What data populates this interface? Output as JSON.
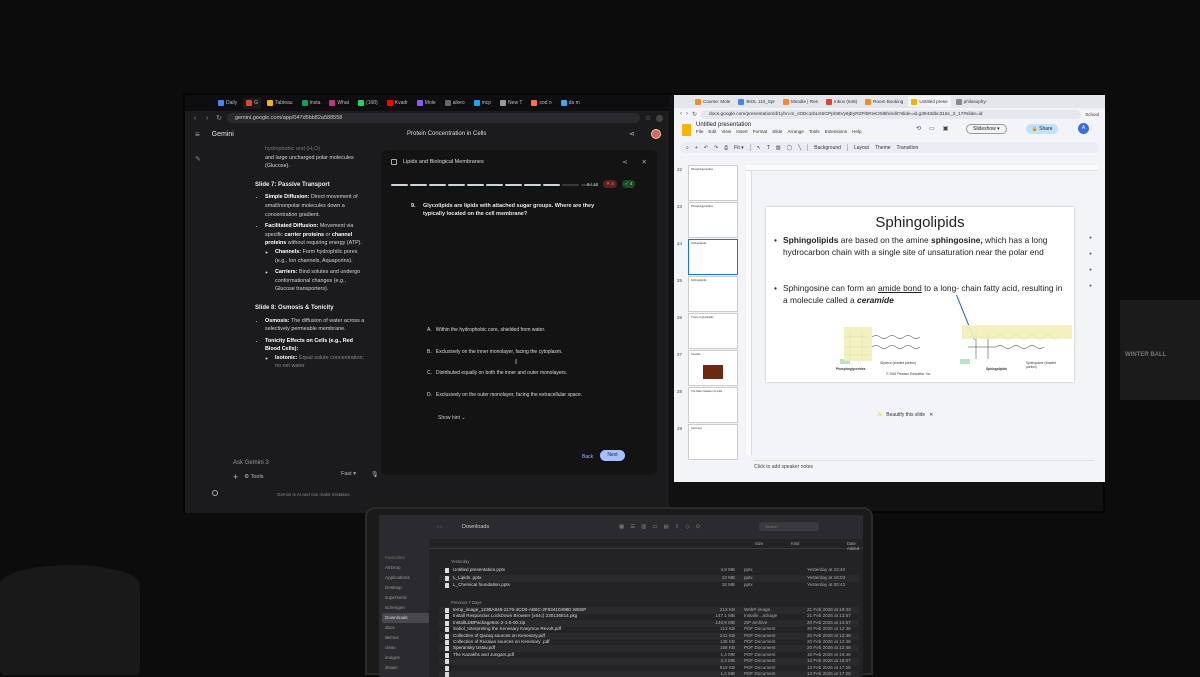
{
  "left_browser": {
    "tabs": [
      "Daily",
      "G",
      "Tableau",
      "Insta",
      "What",
      "(168)",
      "Kvadr",
      "Mole",
      "aikeo",
      "mcp",
      "New T",
      "sod n",
      "da m"
    ],
    "url": "gemini.google.com/app/047d5bb82a588558",
    "brand": "Gemini",
    "chat_title": "Protein Concentration in Cells",
    "notes": {
      "intro": "and large uncharged polar molecules (Glucose).",
      "intro_partial": "hydrophobic and (H₂O)",
      "slide7_title": "Slide 7: Passive Transport",
      "simple_diffusion_label": "Simple Diffusion:",
      "simple_diffusion_text": "Direct movement of small/nonpolar molecules down a concentration gradient.",
      "facilitated_label": "Facilitated Diffusion:",
      "facilitated_text_1": "Movement via specific",
      "carrier_proteins": "carrier proteins",
      "or": "or",
      "channel_proteins": "channel proteins",
      "facilitated_text_2": "without requiring energy (ATP).",
      "channels_label": "Channels:",
      "channels_text": "Form hydrophilic pores (e.g., Ion channels, Aquaporins).",
      "carriers_label": "Carriers:",
      "carriers_text": "Bind solutes and undergo conformational changes (e.g., Glucose transporters).",
      "slide8_title": "Slide 8: Osmosis & Tonicity",
      "osmosis_label": "Osmosis:",
      "osmosis_text": "The diffusion of water across a selectively permeable membrane.",
      "tonicity_label": "Tonicity Effects on Cells (e.g., Red Blood Cells):",
      "isotonic_label": "Isotonic:",
      "isotonic_text": "Equal solute concentration; no net water"
    },
    "ask_placeholder": "Ask Gemini 3",
    "tools_label": "Tools",
    "mode_label": "Fast",
    "disclaimer": "Gemini is AI and can make mistakes.",
    "quiz": {
      "title": "Lipids and Biological Membranes",
      "progress": "9 / 10",
      "progress_fraction": 0.8,
      "wrong_count": "4",
      "right_count": "4",
      "question_number": "9.",
      "question": "Glycolipids are lipids with attached sugar groups. Where are they typically located on the cell membrane?",
      "options": [
        {
          "letter": "A.",
          "text": "Within the hydrophobic core, shielded from water."
        },
        {
          "letter": "B.",
          "text": "Exclusively on the inner monolayer, facing the cytoplasm."
        },
        {
          "letter": "C.",
          "text": "Distributed equally on both the inner and outer monolayers."
        },
        {
          "letter": "D.",
          "text": "Exclusively on the outer monolayer, facing the extracellular space."
        }
      ],
      "show_hint": "Show hint",
      "back": "Back",
      "next": "Next"
    }
  },
  "right_browser": {
    "tabs": [
      "Course: Mole",
      "BIOL 110_Spr",
      "Moodle | Res",
      "Inbox (648)",
      "Room Booking",
      "Untitled prese",
      "philosophy-"
    ],
    "url": "docs.google.com/presentation/d/1yhn-m_cDDc1rbLK6GPpht6Vy6jEyRZFl5RnKz5l5h/edit?slide=id.g3943dbc316c_2_17#slide=id",
    "school_label": "School",
    "doc_title": "Untitled presentation",
    "menus": [
      "File",
      "Edit",
      "View",
      "Insert",
      "Format",
      "Slide",
      "Arrange",
      "Tools",
      "Extensions",
      "Help"
    ],
    "slideshow_label": "Slideshow",
    "share_label": "Share",
    "avatar_letter": "A",
    "toolbar": {
      "zoom": "Fit",
      "background": "Background",
      "layout": "Layout",
      "theme": "Theme",
      "transition": "Transition"
    },
    "thumbnails": [
      {
        "num": "22",
        "text": "Phosphoglycerides"
      },
      {
        "num": "23",
        "text": "Phosphoglycerides"
      },
      {
        "num": "24",
        "text": "Sphingolipids"
      },
      {
        "num": "25",
        "text": "Sphingolipids"
      },
      {
        "num": "26",
        "text": "Types of glycolipids"
      },
      {
        "num": "27",
        "text": "Steroids"
      },
      {
        "num": "28",
        "text": "The Main Classes of Lipids"
      },
      {
        "num": "29",
        "text": "Summary"
      }
    ],
    "slide": {
      "title": "Sphingolipids",
      "b1_strong": "Sphingolipids",
      "b1_mid": "are based on the amine",
      "b1_strong2": "sphingosine,",
      "b1_rest": "which has a long hydrocarbon chain with a single site of unsaturation near the polar end",
      "b2_start": "Sphingosine can form an",
      "b2_link": "amide bond",
      "b2_mid": "to a long- chain fatty acid, resulting in a molecule called a",
      "b2_term": "ceramide",
      "fig_label_left": "Phosphoglycerides",
      "fig_label_glycerol": "Glycerol (shaded portion)",
      "fig_label_right": "Sphingolipids",
      "fig_label_sphingosine": "Sphingosine (shaded portion)",
      "copyright": "© 2016 Pearson Education, Inc."
    },
    "beautify": "Beautify this slide",
    "speaker_notes": "Click to add speaker notes"
  },
  "finder": {
    "location": "Downloads",
    "search_placeholder": "Search",
    "sidebar": {
      "header": "Favourites",
      "items": [
        "AirDrop",
        "Applications",
        "Desktop",
        "supersonic",
        "schengen",
        "Downloads",
        "docs",
        "demos",
        "clean",
        "images",
        "drawn"
      ],
      "selected": "Downloads"
    },
    "columns": {
      "size": "Size",
      "kind": "Kind",
      "date": "Date Added"
    },
    "groups": [
      "Yesterday",
      "Previous 7 Days"
    ],
    "files": [
      {
        "name": "Untitled presentation.pptx",
        "size": "4,9 MB",
        "kind": "pptx",
        "date": "Yesterday at 22:40"
      },
      {
        "name": "L_Lipids .pptx",
        "size": "13 MB",
        "kind": "pptx",
        "date": "Yesterday at 16:03"
      },
      {
        "name": "L_Chemical foundation.pptx",
        "size": "18 MB",
        "kind": "pptx",
        "date": "Yesterday at 00:43"
      },
      {
        "name": "temp_image_123BA846-2176-4CD0-AB6C-2F93410498D.WEBP",
        "size": "213 KB",
        "kind": "WebP image",
        "date": "21 Feb 2026 at 19:43"
      },
      {
        "name": "Install Respondus LockDown Browser (x64c) 230136814.pkg",
        "size": "147.1 MB",
        "kind": "Installe...ackage",
        "date": "21 Feb 2026 at 13:57"
      },
      {
        "name": "InstallLDBPackage64c-2-1-5-00.zip",
        "size": "146,9 MB",
        "kind": "ZIP archive",
        "date": "20 Feb 2026 at 13:57"
      },
      {
        "name": "Sabol_Interpreting the Kenesary Kasymov Revolt.pdf",
        "size": "113 KB",
        "kind": "PDF Document",
        "date": "20 Feb 2026 at 12:48"
      },
      {
        "name": "Collection of Qazaq sources on Kenesary.pdf",
        "size": "241 KB",
        "kind": "PDF Document",
        "date": "20 Feb 2026 at 12:48"
      },
      {
        "name": "Collection of Russian sources on Kenesary .pdf",
        "size": "138 KB",
        "kind": "PDF Document",
        "date": "20 Feb 2026 at 12:48"
      },
      {
        "name": "Speransky Ustav.pdf",
        "size": "156 KB",
        "kind": "PDF Document",
        "date": "20 Feb 2026 at 12:48"
      },
      {
        "name": "The Kazakhs and Jungars.pdf",
        "size": "1,4 MB",
        "kind": "PDF Document",
        "date": "19 Feb 2026 at 16:46"
      },
      {
        "name": "",
        "size": "2,3 MB",
        "kind": "PDF Document",
        "date": "13 Feb 2026 at 18:07"
      },
      {
        "name": "",
        "size": "618 KB",
        "kind": "PDF Document",
        "date": "13 Feb 2026 at 17:28"
      },
      {
        "name": "",
        "size": "1,4 MB",
        "kind": "PDF Document",
        "date": "13 Feb 2026 at 17:28"
      }
    ]
  },
  "decor": {
    "poster_text": "WINTER BALL"
  }
}
